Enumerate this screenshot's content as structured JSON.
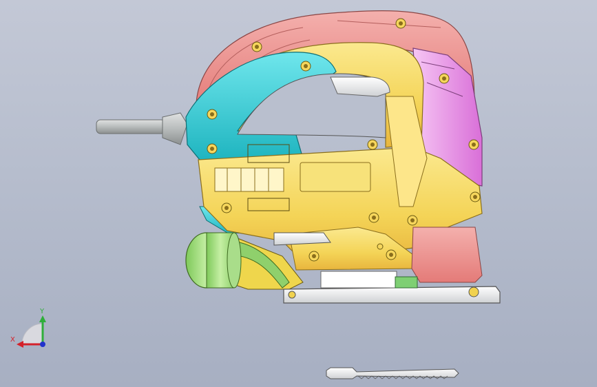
{
  "viewport": {
    "background_top": "#c3c8d6",
    "background_bottom": "#a7afc2"
  },
  "model": {
    "colors": {
      "handle_top": "#ec8f8c",
      "grip": "#2fcfd8",
      "motor_housing": "#f6d65c",
      "rear_panel": "#e9a2e8",
      "dust_port": "#8fd06c",
      "cord": "#b4b8b8",
      "base_plate": "#e6e6e8",
      "blade": "#e8e8e8"
    }
  },
  "triad": {
    "x_label": "X",
    "y_label": "Y",
    "x_color": "#d4212a",
    "y_color": "#2fae3a",
    "z_color": "#2233cc"
  }
}
